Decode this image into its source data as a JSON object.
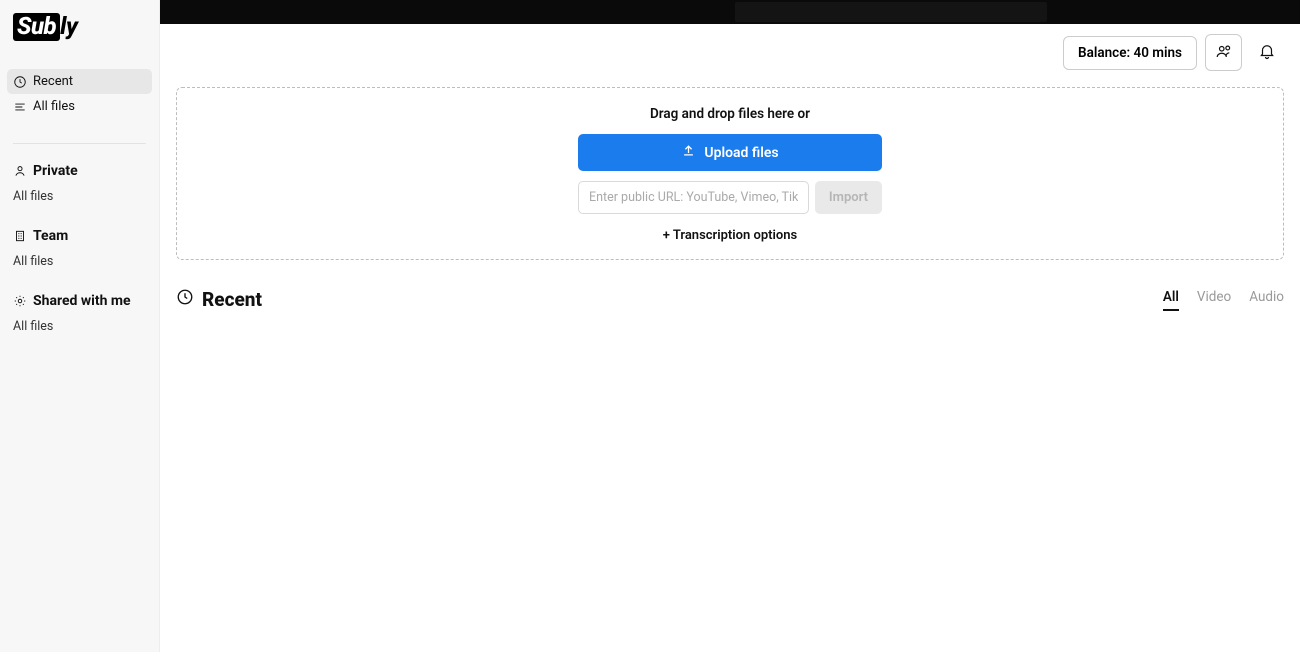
{
  "brand": {
    "boxed": "Sub",
    "tail": "ly"
  },
  "sidebar": {
    "recent": "Recent",
    "all_files": "All files",
    "private": {
      "label": "Private",
      "all_files": "All files"
    },
    "team": {
      "label": "Team",
      "all_files": "All files"
    },
    "shared": {
      "label": "Shared with me",
      "all_files": "All files"
    }
  },
  "header": {
    "balance": "Balance: 40 mins"
  },
  "dropzone": {
    "text": "Drag and drop files here or",
    "upload": "Upload files",
    "url_placeholder": "Enter public URL: YouTube, Vimeo, TikTok...",
    "import": "Import",
    "options": "+ Transcription options"
  },
  "section": {
    "title": "Recent",
    "tabs": {
      "all": "All",
      "video": "Video",
      "audio": "Audio"
    }
  }
}
